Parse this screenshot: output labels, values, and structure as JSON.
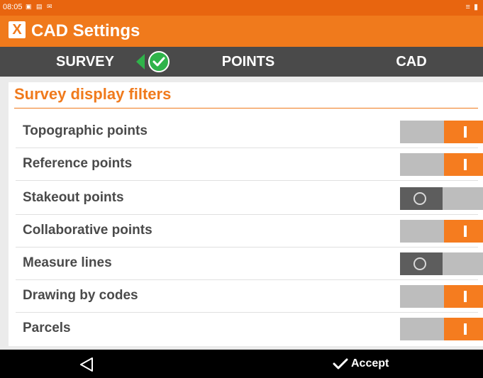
{
  "statusbar": {
    "time": "08:05",
    "left_icons": "▣ ▤ ✉",
    "right_icons": "≡ ▮"
  },
  "appbar": {
    "title": "CAD Settings",
    "logo_text": "X"
  },
  "tabs": [
    {
      "label": "SURVEY",
      "active": true
    },
    {
      "label": "POINTS",
      "active": false
    },
    {
      "label": "CAD",
      "active": false
    }
  ],
  "section": {
    "title": "Survey display filters"
  },
  "rows": [
    {
      "label": "Topographic points",
      "enabled": true
    },
    {
      "label": "Reference points",
      "enabled": true
    },
    {
      "label": "Stakeout points",
      "enabled": false
    },
    {
      "label": "Collaborative points",
      "enabled": true
    },
    {
      "label": "Measure lines",
      "enabled": false
    },
    {
      "label": "Drawing by codes",
      "enabled": true
    },
    {
      "label": "Parcels",
      "enabled": true
    }
  ],
  "navbar": {
    "accept_label": "Accept",
    "back_icon": "back-triangle-icon"
  },
  "colors": {
    "accent": "#f07a1c",
    "tabbar": "#4a4a4a",
    "toggle_on": "#f57c1f",
    "toggle_off": "#5d5d5d"
  }
}
